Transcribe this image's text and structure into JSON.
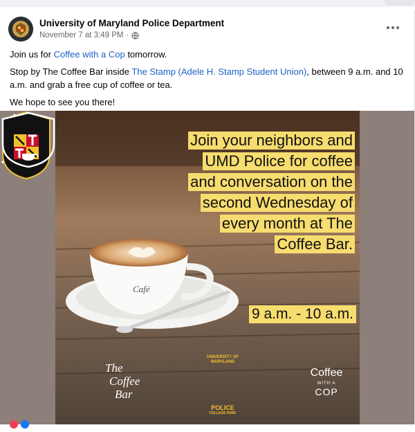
{
  "post": {
    "page_name": "University of Maryland Police Department",
    "timestamp": "November 7 at 3:49 PM",
    "separator": "·",
    "privacy_icon": "globe-icon",
    "more_icon": "more-options-icon",
    "text": {
      "line1_prefix": "Join us for ",
      "line1_link": "Coffee with a Cop",
      "line1_suffix": " tomorrow.",
      "line2_prefix": "Stop by The Coffee Bar inside ",
      "line2_link": "The Stamp (Adele H. Stamp Student Union)",
      "line2_suffix": ", between 9 a.m. and 10 a.m. and grab a free cup of coffee or tea.",
      "line3": "We hope to see you there!"
    }
  },
  "image": {
    "headline_lines": [
      "Join your neighbors and",
      "UMD Police for coffee",
      "and conversation on the",
      "second Wednesday of",
      "every month at The",
      "Coffee Bar."
    ],
    "time": "9 a.m. - 10 a.m.",
    "cup_text": "Café",
    "coffee_bar_logo": [
      "The",
      "Coffee",
      "Bar"
    ],
    "police_badge": {
      "top": "UNIVERSITY OF MARYLAND",
      "label": "POLICE",
      "sub": "COLLEGE PARK"
    },
    "cwac_logo": {
      "coffee": "Coffee",
      "with": "WITH A",
      "cop": "COP"
    },
    "colors": {
      "highlight": "#f7dc6f",
      "link": "#1b63c6",
      "frame": "#8d7f79"
    }
  }
}
